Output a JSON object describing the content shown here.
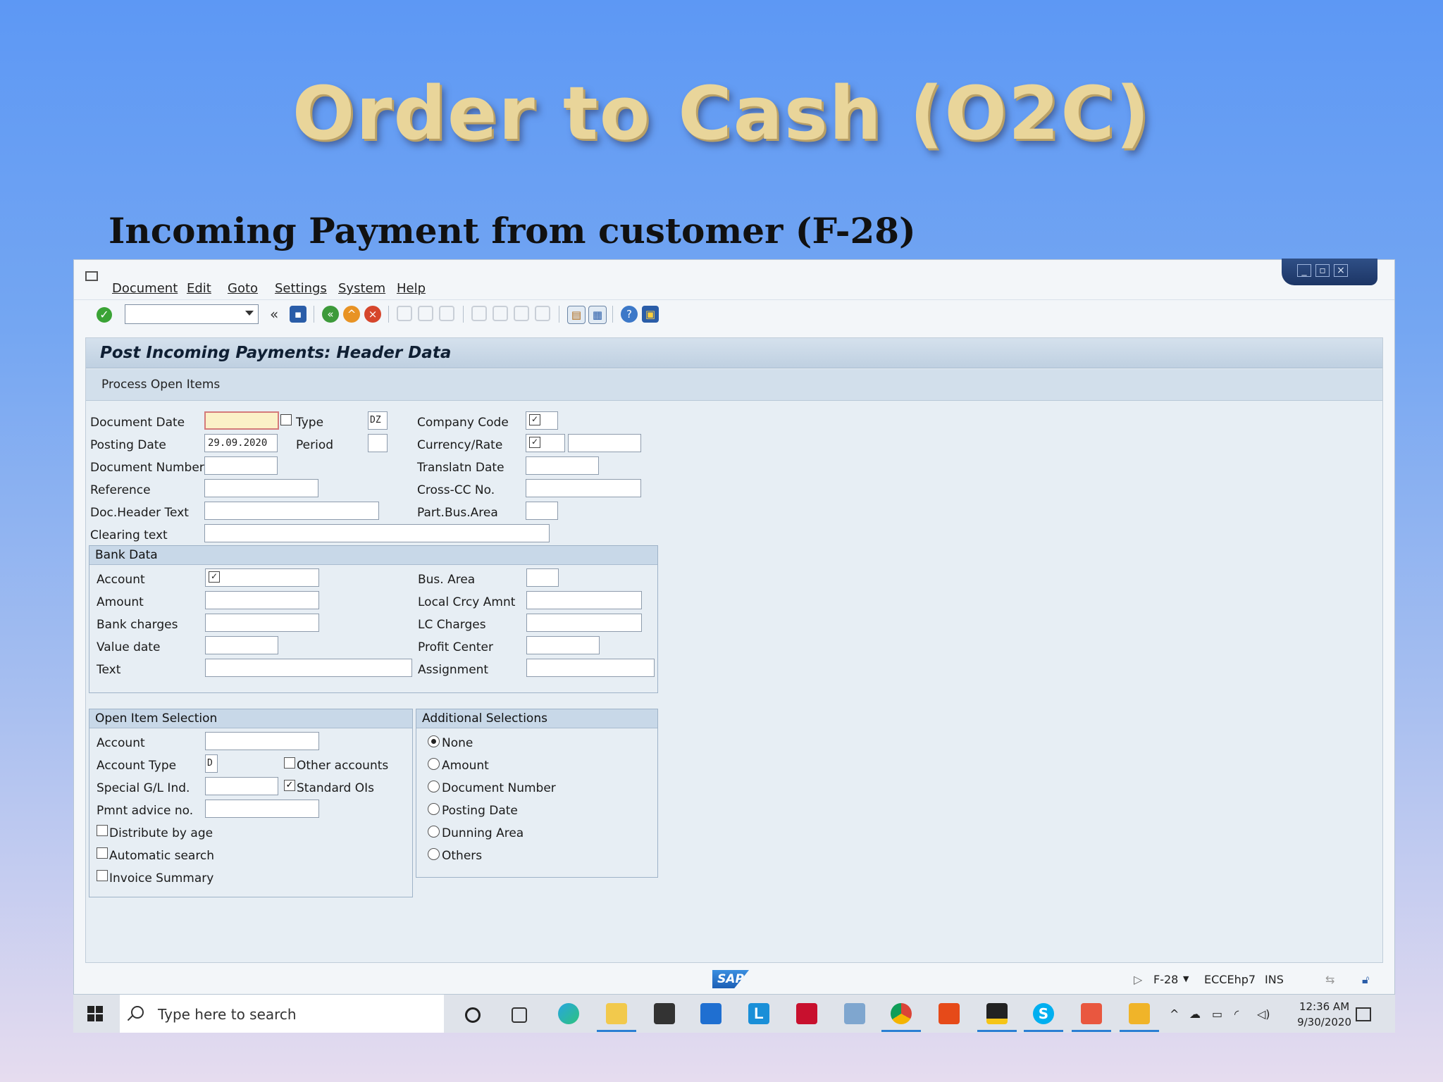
{
  "slide": {
    "title": "Order to Cash (O2C)",
    "subtitle": "Incoming Payment from customer (F-28)"
  },
  "menu": {
    "items": [
      "Document",
      "Edit",
      "Goto",
      "Settings",
      "System",
      "Help"
    ]
  },
  "toolbar": {
    "back_label": "«"
  },
  "screen": {
    "title": "Post Incoming Payments: Header Data",
    "app_toolbar_button": "Process Open Items"
  },
  "header": {
    "document_date_label": "Document Date",
    "document_date_value": "",
    "type_label": "Type",
    "type_value": "DZ",
    "company_code_label": "Company Code",
    "posting_date_label": "Posting Date",
    "posting_date_value": "29.09.2020",
    "period_label": "Period",
    "currency_rate_label": "Currency/Rate",
    "document_number_label": "Document Number",
    "translatn_date_label": "Translatn Date",
    "reference_label": "Reference",
    "cross_cc_label": "Cross-CC No.",
    "doc_header_text_label": "Doc.Header Text",
    "part_bus_area_label": "Part.Bus.Area",
    "clearing_text_label": "Clearing text"
  },
  "bank_data": {
    "title": "Bank Data",
    "account_label": "Account",
    "amount_label": "Amount",
    "bank_charges_label": "Bank charges",
    "value_date_label": "Value date",
    "text_label": "Text",
    "bus_area_label": "Bus. Area",
    "local_crcy_amnt_label": "Local Crcy Amnt",
    "lc_charges_label": "LC Charges",
    "profit_center_label": "Profit Center",
    "assignment_label": "Assignment"
  },
  "open_item_selection": {
    "title": "Open Item Selection",
    "account_label": "Account",
    "account_type_label": "Account Type",
    "account_type_value": "D",
    "other_accounts_label": "Other accounts",
    "special_gl_label": "Special G/L Ind.",
    "standard_ois_label": "Standard OIs",
    "pmnt_advice_label": "Pmnt advice no.",
    "distribute_by_age_label": "Distribute by age",
    "automatic_search_label": "Automatic search",
    "invoice_summary_label": "Invoice Summary"
  },
  "additional_selections": {
    "title": "Additional Selections",
    "options": [
      "None",
      "Amount",
      "Document Number",
      "Posting Date",
      "Dunning Area",
      "Others"
    ],
    "selected": "None"
  },
  "status_bar": {
    "logo": "SAP",
    "transaction": "F-28",
    "system": "ECCEhp7",
    "mode": "INS"
  },
  "taskbar": {
    "search_placeholder": "Type here to search",
    "time": "12:36 AM",
    "date": "9/30/2020"
  }
}
